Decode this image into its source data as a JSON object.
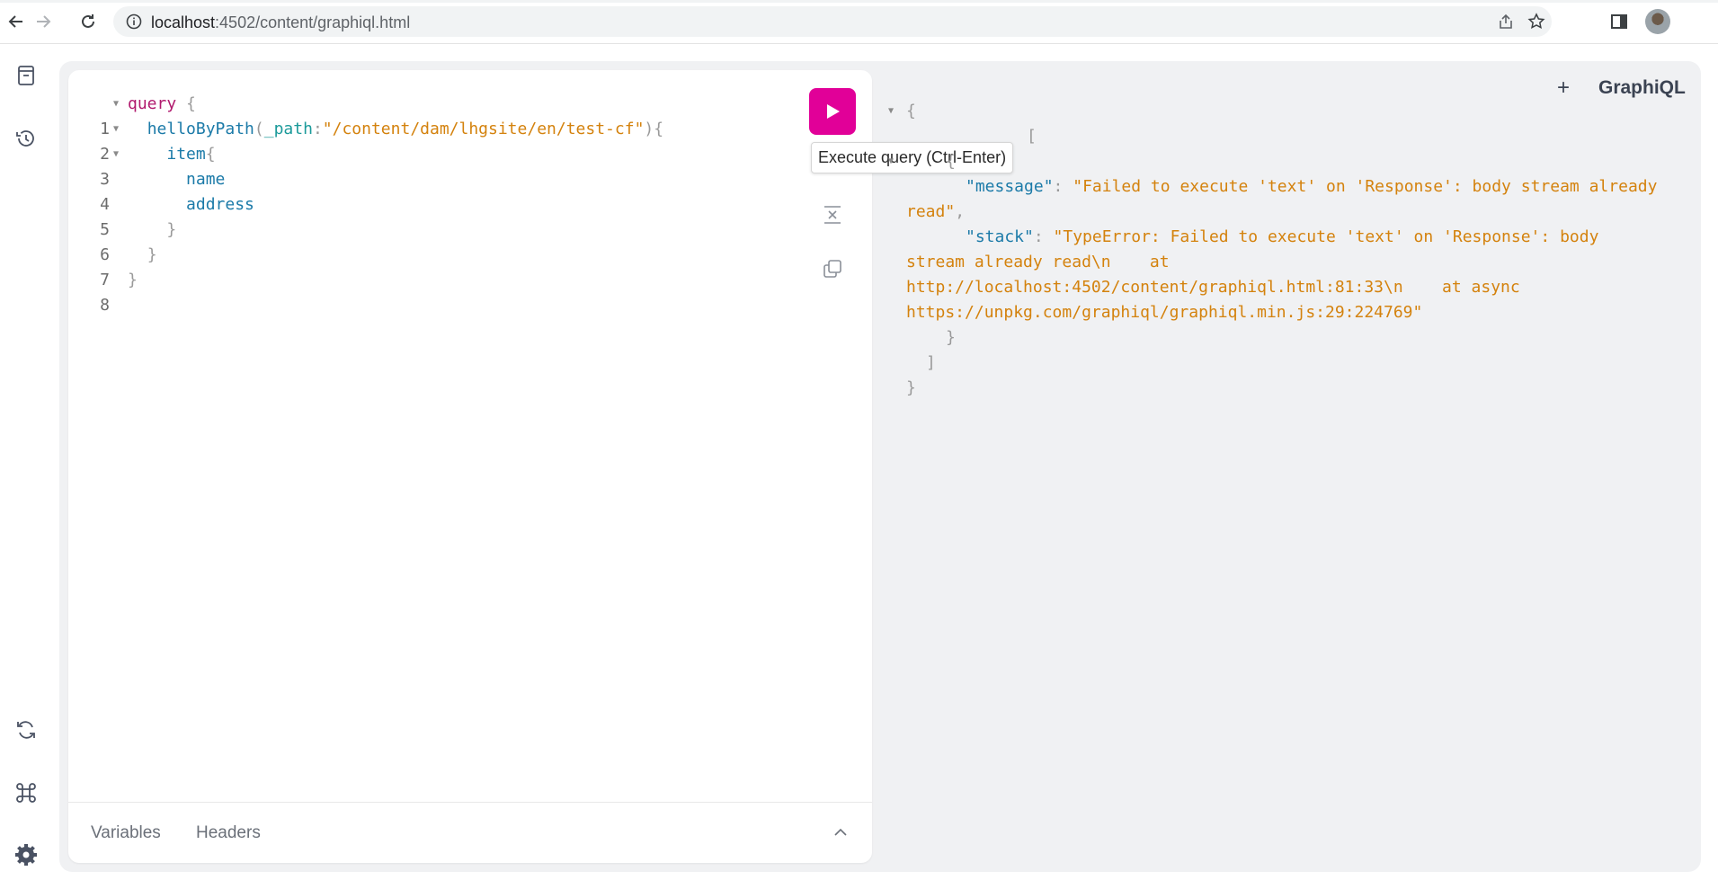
{
  "browser": {
    "url_host": "localhost",
    "url_rest": ":4502/content/graphiql.html"
  },
  "app": {
    "brand": "GraphiQL",
    "new_tab_label": "+",
    "run_tooltip": "Execute query (Ctrl-Enter)"
  },
  "editor": {
    "lines": [
      {
        "n": "1",
        "fold": true
      },
      {
        "n": "2",
        "fold": true
      },
      {
        "n": "3",
        "fold": true
      },
      {
        "n": "4",
        "fold": false
      },
      {
        "n": "5",
        "fold": false
      },
      {
        "n": "6",
        "fold": false
      },
      {
        "n": "7",
        "fold": false
      },
      {
        "n": "8",
        "fold": false
      }
    ],
    "code": {
      "l1_kw": "query",
      "l1_brace": " {",
      "l2_fn": "helloByPath",
      "l2_open": "(",
      "l2_arg": "_path",
      "l2_colon": ":",
      "l2_str": "\"/content/dam/lhgsite/en/test-cf\"",
      "l2_close": "){",
      "l3_fn": "item",
      "l3_brace": "{",
      "l4_field": "name",
      "l5_field": "address",
      "l6": "}",
      "l7": "}",
      "l8": "}"
    },
    "footer": {
      "variables_tab": "Variables",
      "headers_tab": "Headers"
    }
  },
  "result": {
    "open_brace": "{",
    "errors_bracket": "[",
    "obj_open": "{",
    "message_key": "\"message\"",
    "message_val_1": "\"Failed to execute 'text' on 'Response': body stream already",
    "message_val_2": "read\"",
    "stack_key": "\"stack\"",
    "stack_val_1": "\"TypeError: Failed to execute 'text' on 'Response': body",
    "stack_val_2": "stream already read\\n    at",
    "stack_val_3": "http://localhost:4502/content/graphiql.html:81:33\\n    at async",
    "stack_val_4": "https://unpkg.com/graphiql/graphiql.min.js:29:224769\"",
    "obj_close": "}",
    "bracket_close": "]",
    "close_brace": "}"
  }
}
